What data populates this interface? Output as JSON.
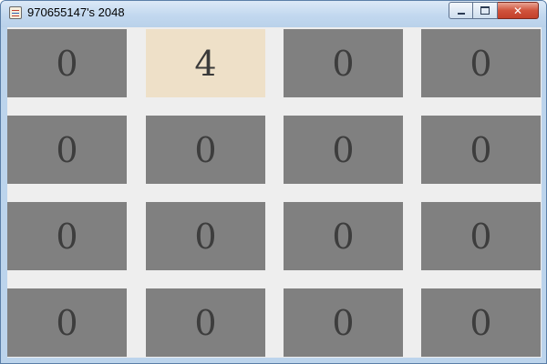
{
  "window": {
    "title": "970655147's 2048",
    "close_glyph": "✕"
  },
  "board": {
    "rows": [
      [
        "0",
        "4",
        "0",
        "0"
      ],
      [
        "0",
        "0",
        "0",
        "0"
      ],
      [
        "0",
        "0",
        "0",
        "0"
      ],
      [
        "0",
        "0",
        "0",
        "0"
      ]
    ]
  },
  "colors": {
    "empty_tile": "#808080",
    "tile_4": "#eee0c8",
    "board_background": "#eeeeee"
  }
}
